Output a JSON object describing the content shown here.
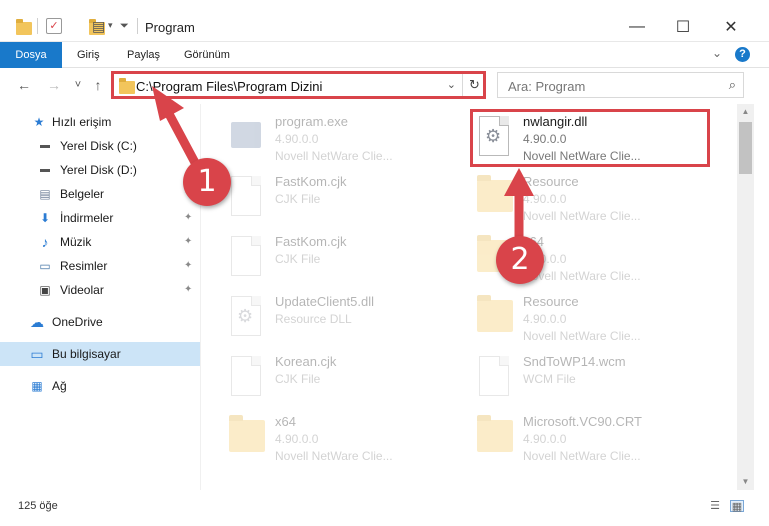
{
  "window": {
    "title": "Program",
    "minimize_glyph": "—",
    "maximize_glyph": "☐",
    "close_glyph": "✕"
  },
  "ribbon": {
    "tabs": [
      {
        "label": "Dosya",
        "active": true
      },
      {
        "label": "Giriş"
      },
      {
        "label": "Paylaş"
      },
      {
        "label": "Görünüm"
      }
    ],
    "help_label": "?"
  },
  "navigation": {
    "back_glyph": "←",
    "forward_glyph": "→",
    "recent_glyph": "˅",
    "up_glyph": "↑",
    "address_path": "C:\\Program Files\\Program Dizini",
    "refresh_glyph": "↻",
    "search_placeholder": "Ara: Program",
    "search_glyph": "⌕"
  },
  "sidebar": {
    "items": [
      {
        "label": "Hızlı erişim",
        "icon": "star-icon",
        "glyph": "★",
        "color": "#2b7cd3"
      },
      {
        "label": "Yerel Disk (C:)",
        "icon": "drive-icon",
        "glyph": "▬",
        "color": "#555555"
      },
      {
        "label": "Yerel Disk (D:)",
        "icon": "drive-icon",
        "glyph": "▬",
        "color": "#555555"
      },
      {
        "label": "Belgeler",
        "icon": "documents-icon",
        "glyph": "▤",
        "color": "#6f7f99",
        "pinned": true
      },
      {
        "label": "İndirmeler",
        "icon": "download-icon",
        "glyph": "⬇",
        "color": "#2b7cd3",
        "pinned": true
      },
      {
        "label": "Müzik",
        "icon": "music-icon",
        "glyph": "♪",
        "color": "#2b7cd3",
        "pinned": true
      },
      {
        "label": "Resimler",
        "icon": "pictures-icon",
        "glyph": "▭",
        "color": "#4a79a8",
        "pinned": true
      },
      {
        "label": "Videolar",
        "icon": "videos-icon",
        "glyph": "▣",
        "color": "#444444",
        "pinned": true
      },
      {
        "label": "OneDrive",
        "icon": "cloud-icon",
        "glyph": "☁",
        "color": "#2b7cd3"
      },
      {
        "label": "Bu bilgisayar",
        "icon": "computer-icon",
        "glyph": "▭",
        "color": "#2b7cd3",
        "selected": true
      },
      {
        "label": "Ağ",
        "icon": "network-icon",
        "glyph": "▦",
        "color": "#2b7cd3"
      }
    ],
    "pin_glyph": "📌"
  },
  "files": [
    {
      "name": "program.exe",
      "line1": "4.90.0.0",
      "line2": "Novell NetWare Clie...",
      "type": "exe",
      "faded": true
    },
    {
      "name": "nwlangir.dll",
      "line1": "4.90.0.0",
      "line2": "Novell NetWare Clie...",
      "type": "dll",
      "faded": false,
      "highlighted": true
    },
    {
      "name": "FastKom.cjk",
      "line1": "CJK File",
      "line2": "",
      "type": "doc",
      "faded": true
    },
    {
      "name": "Resource",
      "line1": "4.90.0.0",
      "line2": "Novell NetWare Clie...",
      "type": "folder",
      "faded": true
    },
    {
      "name": "FastKom.cjk",
      "line1": "CJK File",
      "line2": "",
      "type": "doc",
      "faded": true
    },
    {
      "name": "x64",
      "line1": "4.90.0.0",
      "line2": "Novell NetWare Clie...",
      "type": "folder",
      "faded": true
    },
    {
      "name": "UpdateClient5.dll",
      "line1": "Resource DLL",
      "line2": "",
      "type": "dll",
      "faded": true
    },
    {
      "name": "Resource",
      "line1": "4.90.0.0",
      "line2": "Novell NetWare Clie...",
      "type": "folder",
      "faded": true
    },
    {
      "name": "Korean.cjk",
      "line1": "CJK File",
      "line2": "",
      "type": "doc",
      "faded": true
    },
    {
      "name": "SndToWP14.wcm",
      "line1": "WCM File",
      "line2": "",
      "type": "doc",
      "faded": true
    },
    {
      "name": "x64",
      "line1": "4.90.0.0",
      "line2": "Novell NetWare Clie...",
      "type": "folder",
      "faded": true
    },
    {
      "name": "Microsoft.VC90.CRT",
      "line1": "4.90.0.0",
      "line2": "Novell NetWare Clie...",
      "type": "folder",
      "faded": true
    }
  ],
  "status": {
    "item_count": "125 öğe"
  },
  "annotations": [
    {
      "label": "1",
      "color": "#d9444a"
    },
    {
      "label": "2",
      "color": "#d9444a"
    }
  ]
}
